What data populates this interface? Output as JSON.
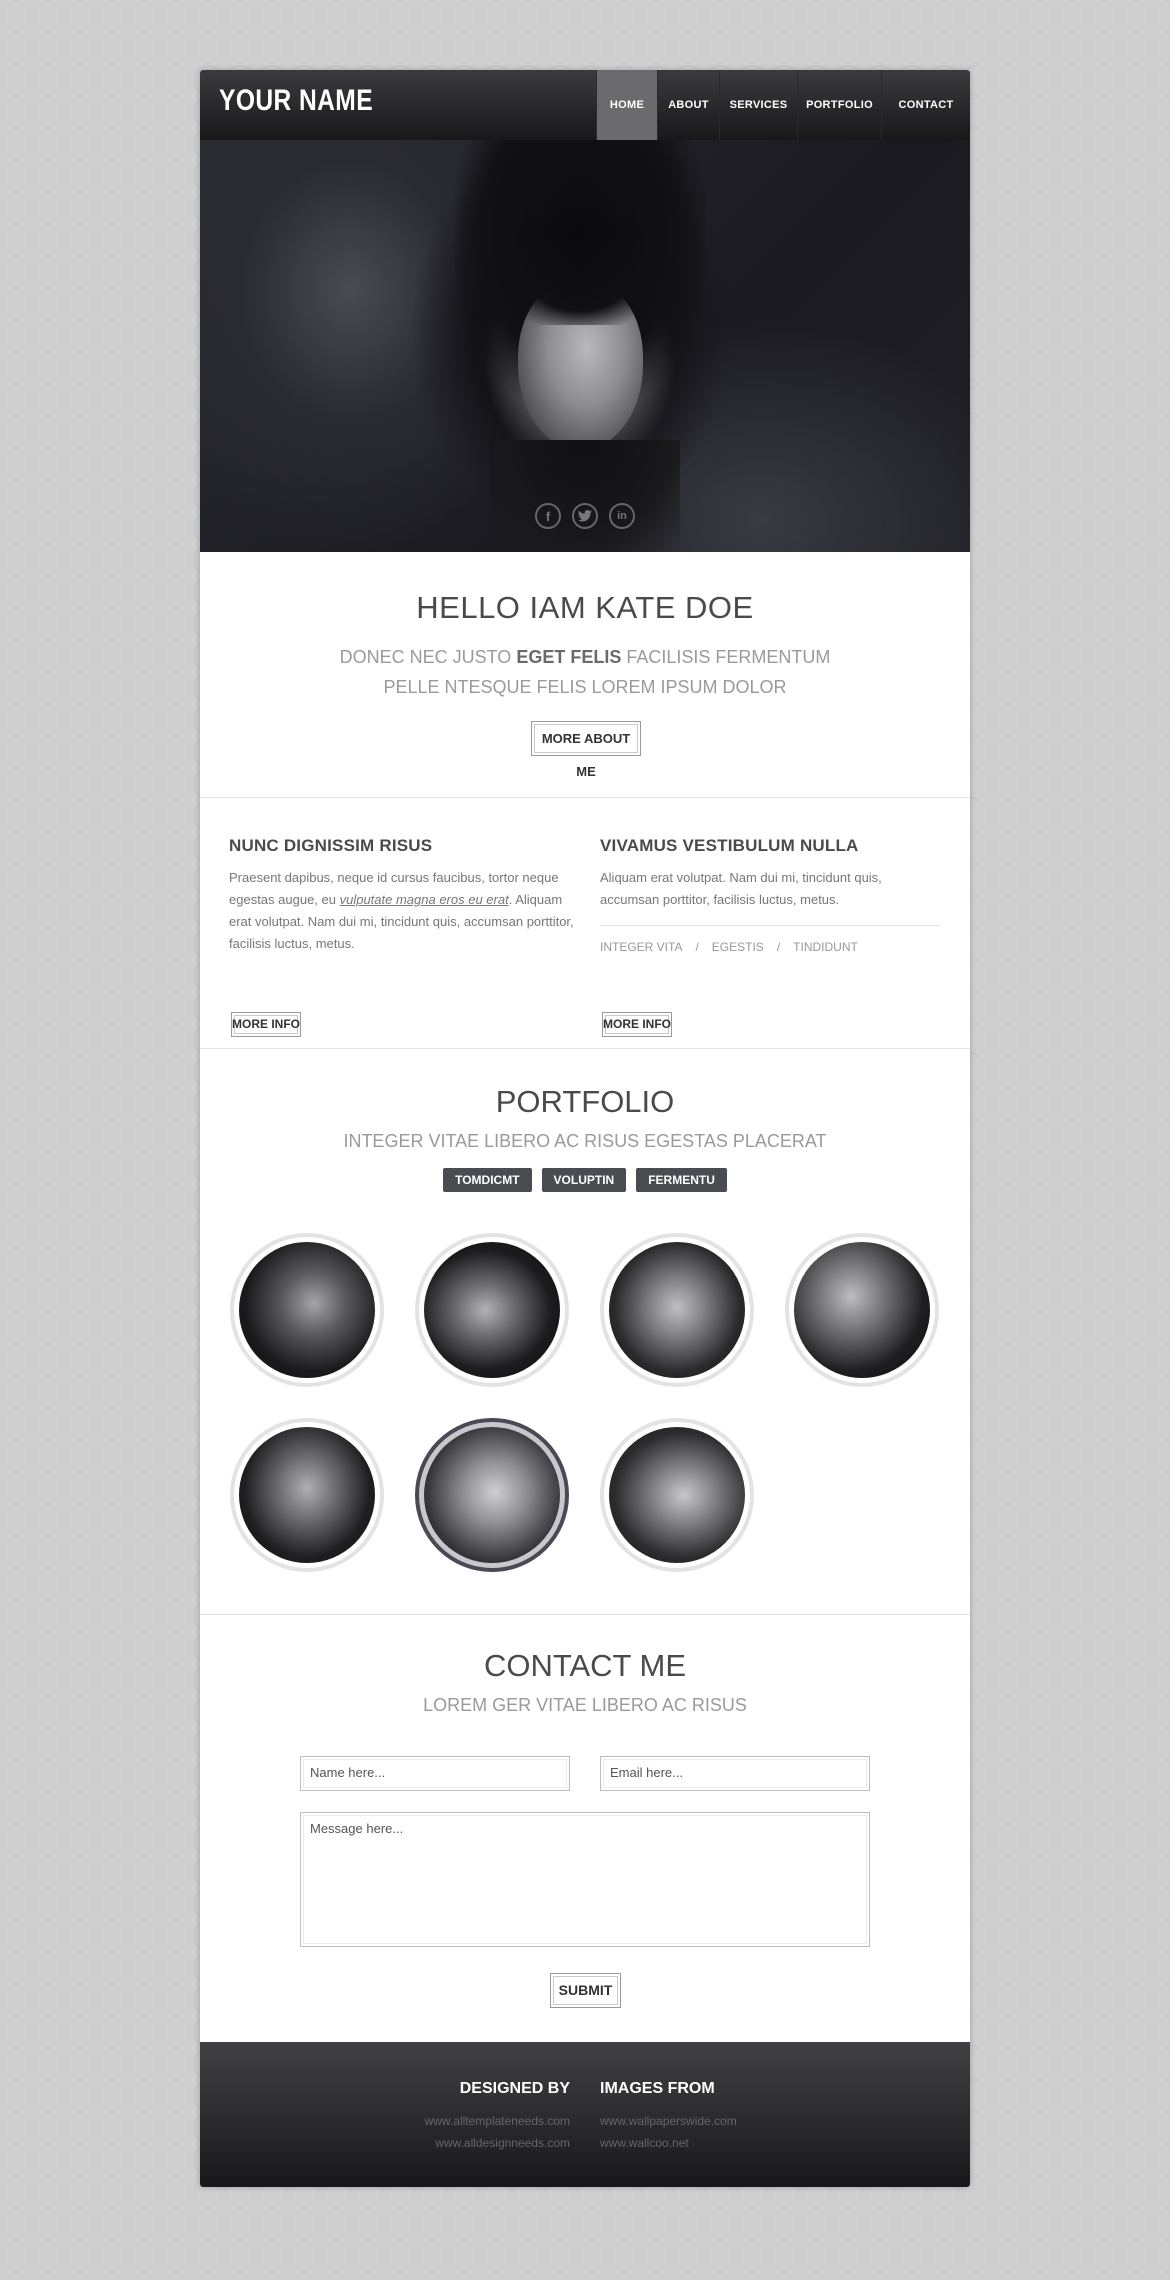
{
  "header": {
    "logo": "YOUR NAME",
    "nav": [
      "HOME",
      "ABOUT",
      "SERVICES",
      "PORTFOLIO",
      "CONTACT"
    ],
    "active_index": 0
  },
  "hero": {
    "socials": [
      {
        "icon": "facebook-icon",
        "glyph": "f"
      },
      {
        "icon": "twitter-icon",
        "glyph": "t"
      },
      {
        "icon": "linkedin-icon",
        "glyph": "in"
      }
    ]
  },
  "intro": {
    "title": "HELLO IAM KATE DOE",
    "line1_pre": "DONEC NEC JUSTO ",
    "line1_bold": "EGET FELIS",
    "line1_post": " FACILISIS FERMENTUM",
    "line2": "PELLE NTESQUE FELIS LOREM IPSUM DOLOR",
    "button": "MORE ABOUT ME"
  },
  "features": [
    {
      "title": "NUNC DIGNISSIM RISUS",
      "text_pre": "Praesent dapibus, neque id cursus faucibus, tortor neque egestas augue, eu ",
      "text_em": "vulputate magna eros eu erat",
      "text_post": ". Aliquam erat volutpat. Nam dui mi, tincidunt quis, accumsan porttitor, facilisis luctus, metus.",
      "button": "MORE INFO"
    },
    {
      "title": "VIVAMUS VESTIBULUM NULLA",
      "text": "Aliquam erat volutpat. Nam dui mi, tincidunt quis, accumsan porttitor, facilisis luctus, metus.",
      "tags": [
        "INTEGER VITA",
        "EGESTIS",
        "TINDIDUNT"
      ],
      "tag_separator": "/",
      "button": "MORE INFO"
    }
  ],
  "portfolio": {
    "title": "PORTFOLIO",
    "subtitle": "INTEGER VITAE LIBERO AC RISUS EGESTAS PLACERAT",
    "filters": [
      "TOMDICMT",
      "VOLUPTIN",
      "FERMENTU"
    ],
    "item_count": 7
  },
  "contact": {
    "title": "CONTACT ME",
    "subtitle": "LOREM GER VITAE LIBERO AC RISUS",
    "name_placeholder": "Name here...",
    "email_placeholder": "Email here...",
    "message_placeholder": "Message here...",
    "submit": "SUBMIT"
  },
  "footer": {
    "designed_by_title": "DESIGNED BY",
    "designed_by_links": [
      "www.alltemplateneeds.com",
      "www.alldesignneeds.com"
    ],
    "images_from_title": "IMAGES FROM",
    "images_from_links": [
      "www.wallpaperswide.com",
      "www.wallcoo.net"
    ]
  },
  "colors": {
    "header_top": "#3b3b3f",
    "header_bottom": "#18181b",
    "nav_active": "#6b6b6e",
    "filter_bg": "#4b4b52",
    "heading": "#4a4a4a",
    "muted": "#9a9a9a"
  }
}
